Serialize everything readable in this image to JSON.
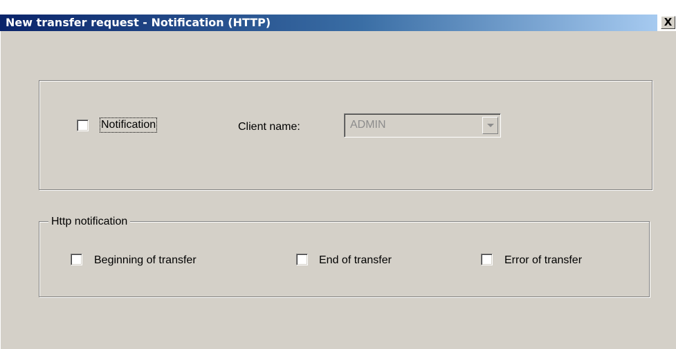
{
  "window": {
    "title": "New transfer request - Notification (HTTP)",
    "close_label": "X"
  },
  "notification_section": {
    "notification_label": "Notification",
    "notification_checked": false,
    "client_name_label": "Client name:",
    "client_name_value": "ADMIN",
    "client_name_enabled": false
  },
  "http_notification": {
    "group_label": "Http notification",
    "options": [
      {
        "label": "Beginning of transfer",
        "checked": false
      },
      {
        "label": "End of transfer",
        "checked": false
      },
      {
        "label": "Error of transfer",
        "checked": false
      }
    ]
  },
  "colors": {
    "dialog_background": "#d4d0c8",
    "titlebar_start": "#0a246a",
    "titlebar_end": "#a6caf0",
    "disabled_text": "#8c8c8c"
  },
  "icons": {
    "close": "close-icon",
    "dropdown": "chevron-down-icon"
  }
}
